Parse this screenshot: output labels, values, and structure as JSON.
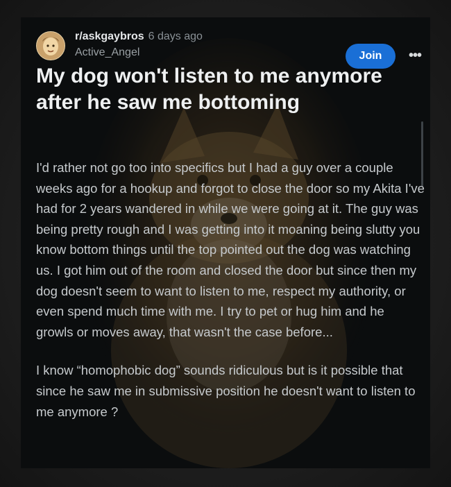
{
  "post": {
    "subreddit": "r/askgaybros",
    "time_ago": "6 days ago",
    "author": "Active_Angel",
    "join_label": "Join",
    "more_icon": "more-horizontal-icon",
    "title": "My dog won't listen to me anymore after he saw me bottoming",
    "body": [
      "I'd rather not go too into specifics but I had a guy over a couple weeks ago for a hookup and forgot to close the door so my Akita I've had for 2 years wandered in while we were going at it. The guy was being pretty rough and I was getting into it moaning being slutty you know bottom things until the top pointed out the dog was watching us. I got him out of the room and closed the door but since then my dog doesn't seem to want to listen to me, respect my authority, or even spend much time with me. I try to pet or hug him and he growls or moves away, that wasn't the case before...",
      "I know “homophobic dog” sounds ridiculous but is it possible that since he saw me in submissive position he doesn't want to listen to me anymore ?"
    ]
  },
  "colors": {
    "card_background": "#0b0d0e",
    "join_button": "#1a6fd6",
    "title_text": "#eef0f1",
    "body_text": "#c6cacd"
  }
}
